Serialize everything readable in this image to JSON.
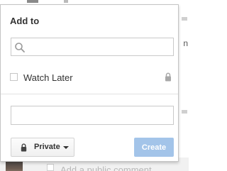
{
  "popup": {
    "title": "Add to",
    "search": {
      "value": "",
      "placeholder": "",
      "icon": "search-icon"
    },
    "playlists": [
      {
        "label": "Watch Later",
        "checked": false,
        "privacy_icon": "lock-icon"
      }
    ],
    "new_playlist": {
      "name_value": "",
      "name_placeholder": ""
    },
    "privacy_button": {
      "label": "Private",
      "icon": "lock-icon",
      "caret_icon": "caret-down-icon"
    },
    "create_button": {
      "label": "Create",
      "enabled": false
    }
  },
  "background": {
    "comment_placeholder": "Add a public comment..."
  },
  "colors": {
    "create_button_bg": "#a3c4e9",
    "text": "#333333",
    "border": "#c9c9c9"
  }
}
